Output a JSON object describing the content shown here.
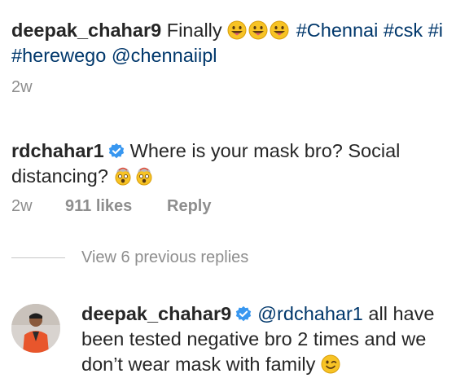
{
  "post": {
    "author": "deepak_chahar9",
    "text": "Finally",
    "emojis": [
      "grinning-tongue-out-emoji",
      "grinning-tongue-out-emoji",
      "grinning-tongue-out-emoji"
    ],
    "hashtags_line1": "#Chennai #csk #i",
    "hashtags_line2": "#herewego @chennaiipl",
    "time": "2w"
  },
  "comment": {
    "author": "rdchahar1",
    "text_line1": "Where is your mask bro? Social",
    "text_line2": "distancing?",
    "emojis": [
      "exploding-head-emoji",
      "exploding-head-emoji"
    ],
    "time": "2w",
    "likes": "911 likes",
    "reply_label": "Reply"
  },
  "view_replies": "View 6 previous replies",
  "reply": {
    "author": "deepak_chahar9",
    "mention": "@rdchahar1",
    "text_line1": " all have",
    "text_line2": "been tested negative bro 2 times and we",
    "text_line3": "don’t wear mask with family",
    "emoji": "winking-face-emoji"
  },
  "colors": {
    "text": "#262626",
    "link": "#00376b",
    "muted": "#8e8e8e",
    "verified": "#3897f0"
  }
}
